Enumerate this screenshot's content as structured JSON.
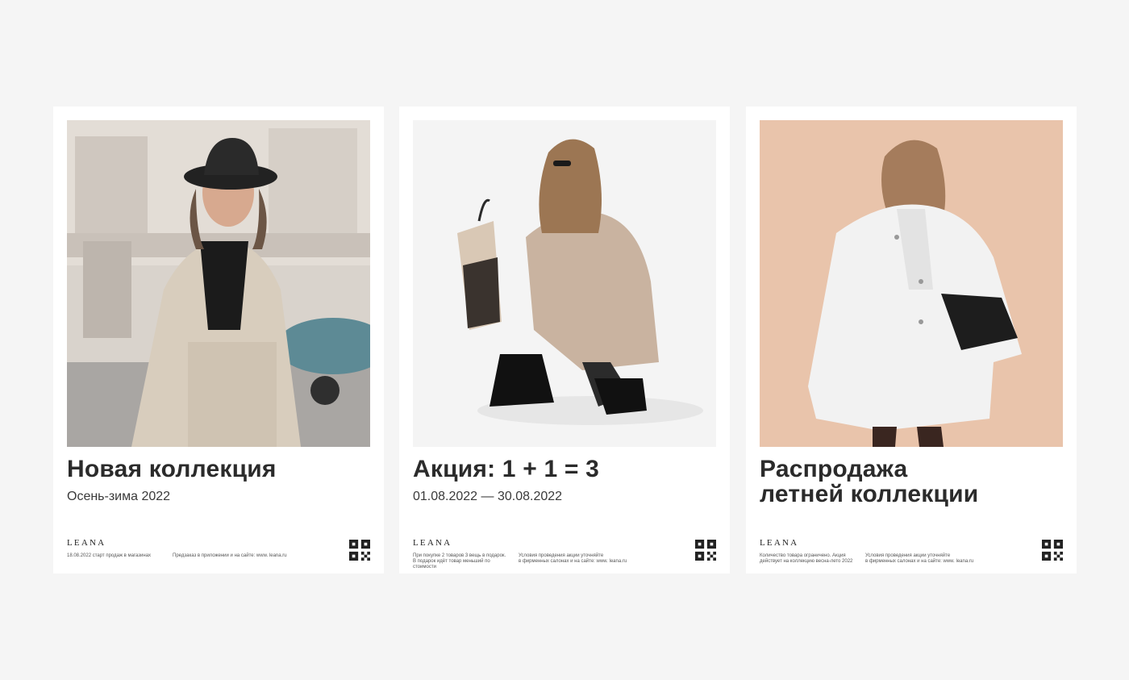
{
  "posters": [
    {
      "title": "Новая коллекция",
      "subtitle": "Осень-зима 2022",
      "brand": "LEANA",
      "note_left": "18.08.2022 старт продаж в магазинах",
      "note_right": "Предзаказ в приложении и на сайте: www. leana.ru",
      "photo_bg": "#d9d3cc"
    },
    {
      "title": "Акция: 1 + 1 = 3",
      "subtitle": "01.08.2022 — 30.08.2022",
      "brand": "LEANA",
      "note_left": "При покупке 2 товаров 3 вещь в подарок.\nВ подарок идёт товар меньший по стоимости",
      "note_right": "Условия проведения акции уточняйте\nв фирменных салонах и на сайте: www. leana.ru",
      "photo_bg": "#f4f4f4"
    },
    {
      "title": "Распродажа\nлетней коллекции",
      "subtitle": "",
      "brand": "LEANA",
      "note_left": "Количество товара ограничено. Акция\nдействует на коллекцию весна-лето 2022",
      "note_right": "Условия проведения акции уточняйте\nв фирменных салонах и на сайте: www. leana.ru",
      "photo_bg": "#e9c4ab"
    }
  ]
}
